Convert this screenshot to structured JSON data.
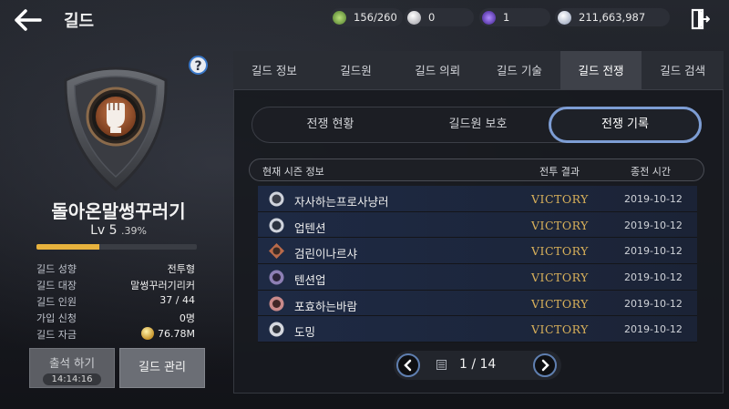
{
  "header": {
    "title": "길드",
    "resources": [
      {
        "icon": "leaf-energy-icon",
        "value": "156/260",
        "color": "#8fcf5a"
      },
      {
        "icon": "pearl-icon",
        "value": "0",
        "color": "#e8e8e8"
      },
      {
        "icon": "purple-orb-icon",
        "value": "1",
        "color": "#7a4de0"
      },
      {
        "icon": "silver-coin-icon",
        "value": "211,663,987",
        "color": "#cfd7e6"
      }
    ]
  },
  "guild": {
    "name": "돌아온말썽꾸러기",
    "level": "Lv 5",
    "exp_pct": ".39%",
    "exp_bar_fraction": 0.39,
    "info": [
      {
        "key": "길드 성향",
        "value": "전투형"
      },
      {
        "key": "길드 대장",
        "value": "말썽꾸러기리커"
      },
      {
        "key": "길드 인원",
        "value": "37 / 44"
      },
      {
        "key": "가입 신청",
        "value": "0명"
      },
      {
        "key": "길드 자금",
        "value": "76.78M"
      }
    ],
    "attend_label": "출석 하기",
    "attend_timer": "14:14:16",
    "manage_label": "길드 관리"
  },
  "tabs": [
    "길드 정보",
    "길드원",
    "길드 의뢰",
    "길드 기술",
    "길드 전쟁",
    "길드 검색"
  ],
  "active_tab": "길드 전쟁",
  "subtabs": [
    "전쟁 현황",
    "길드원 보호",
    "전쟁 기록"
  ],
  "active_subtab": "전쟁 기록",
  "table": {
    "headers": [
      "현재 시즌 정보",
      "전투 결과",
      "종전 시간"
    ],
    "rows": [
      {
        "name": "자사하는프로사냥러",
        "result": "VICTORY",
        "date": "2019-10-12"
      },
      {
        "name": "업텐션",
        "result": "VICTORY",
        "date": "2019-10-12"
      },
      {
        "name": "검린이나르샤",
        "result": "VICTORY",
        "date": "2019-10-12"
      },
      {
        "name": "텐션업",
        "result": "VICTORY",
        "date": "2019-10-12"
      },
      {
        "name": "포효하는바람",
        "result": "VICTORY",
        "date": "2019-10-12"
      },
      {
        "name": "도밍",
        "result": "VICTORY",
        "date": "2019-10-12"
      }
    ]
  },
  "pagination": {
    "current": "1 / 14"
  },
  "colors": {
    "accent": "#7d9dd4",
    "victory": "#d9b15a",
    "exp": "#e7b23d"
  }
}
